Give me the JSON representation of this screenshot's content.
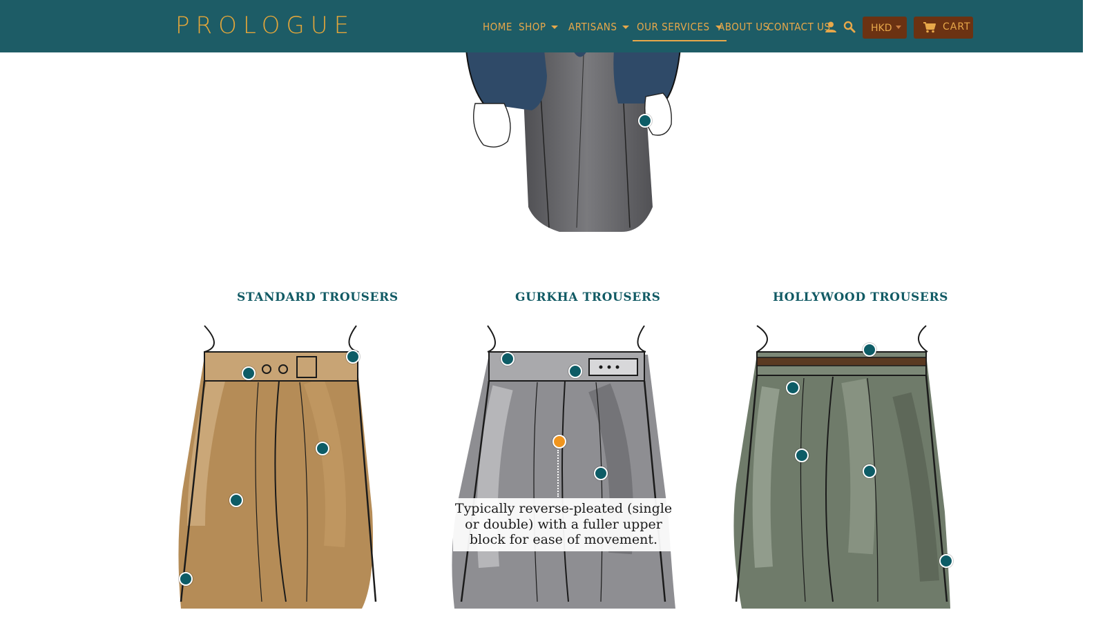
{
  "header": {
    "logo": "PROLOGUE",
    "nav": [
      {
        "label": "HOME"
      },
      {
        "label": "SHOP"
      },
      {
        "label": "ARTISANS"
      },
      {
        "label": "OUR SERVICES"
      },
      {
        "label": "ABOUT US"
      },
      {
        "label": "CONTACT US"
      }
    ],
    "account_icon": "account-icon",
    "search_icon": "search-icon",
    "currency": "HKD",
    "cart_label": "CART",
    "cart_icon": "cart-icon"
  },
  "colors": {
    "header_bg": "#1d5c66",
    "accent": "#e8a84a",
    "button_bg": "#6b3212",
    "heading": "#115a64",
    "hotspot": "#0d5c66",
    "hotspot_active": "#f0951e"
  },
  "sections": [
    {
      "title": "STANDARD TROUSERS"
    },
    {
      "title": "GURKHA TROUSERS"
    },
    {
      "title": "HOLLYWOOD TROUSERS"
    }
  ],
  "tooltip": {
    "text": "Typically reverse-pleated (single or double) with a fuller upper block for ease of movement."
  }
}
